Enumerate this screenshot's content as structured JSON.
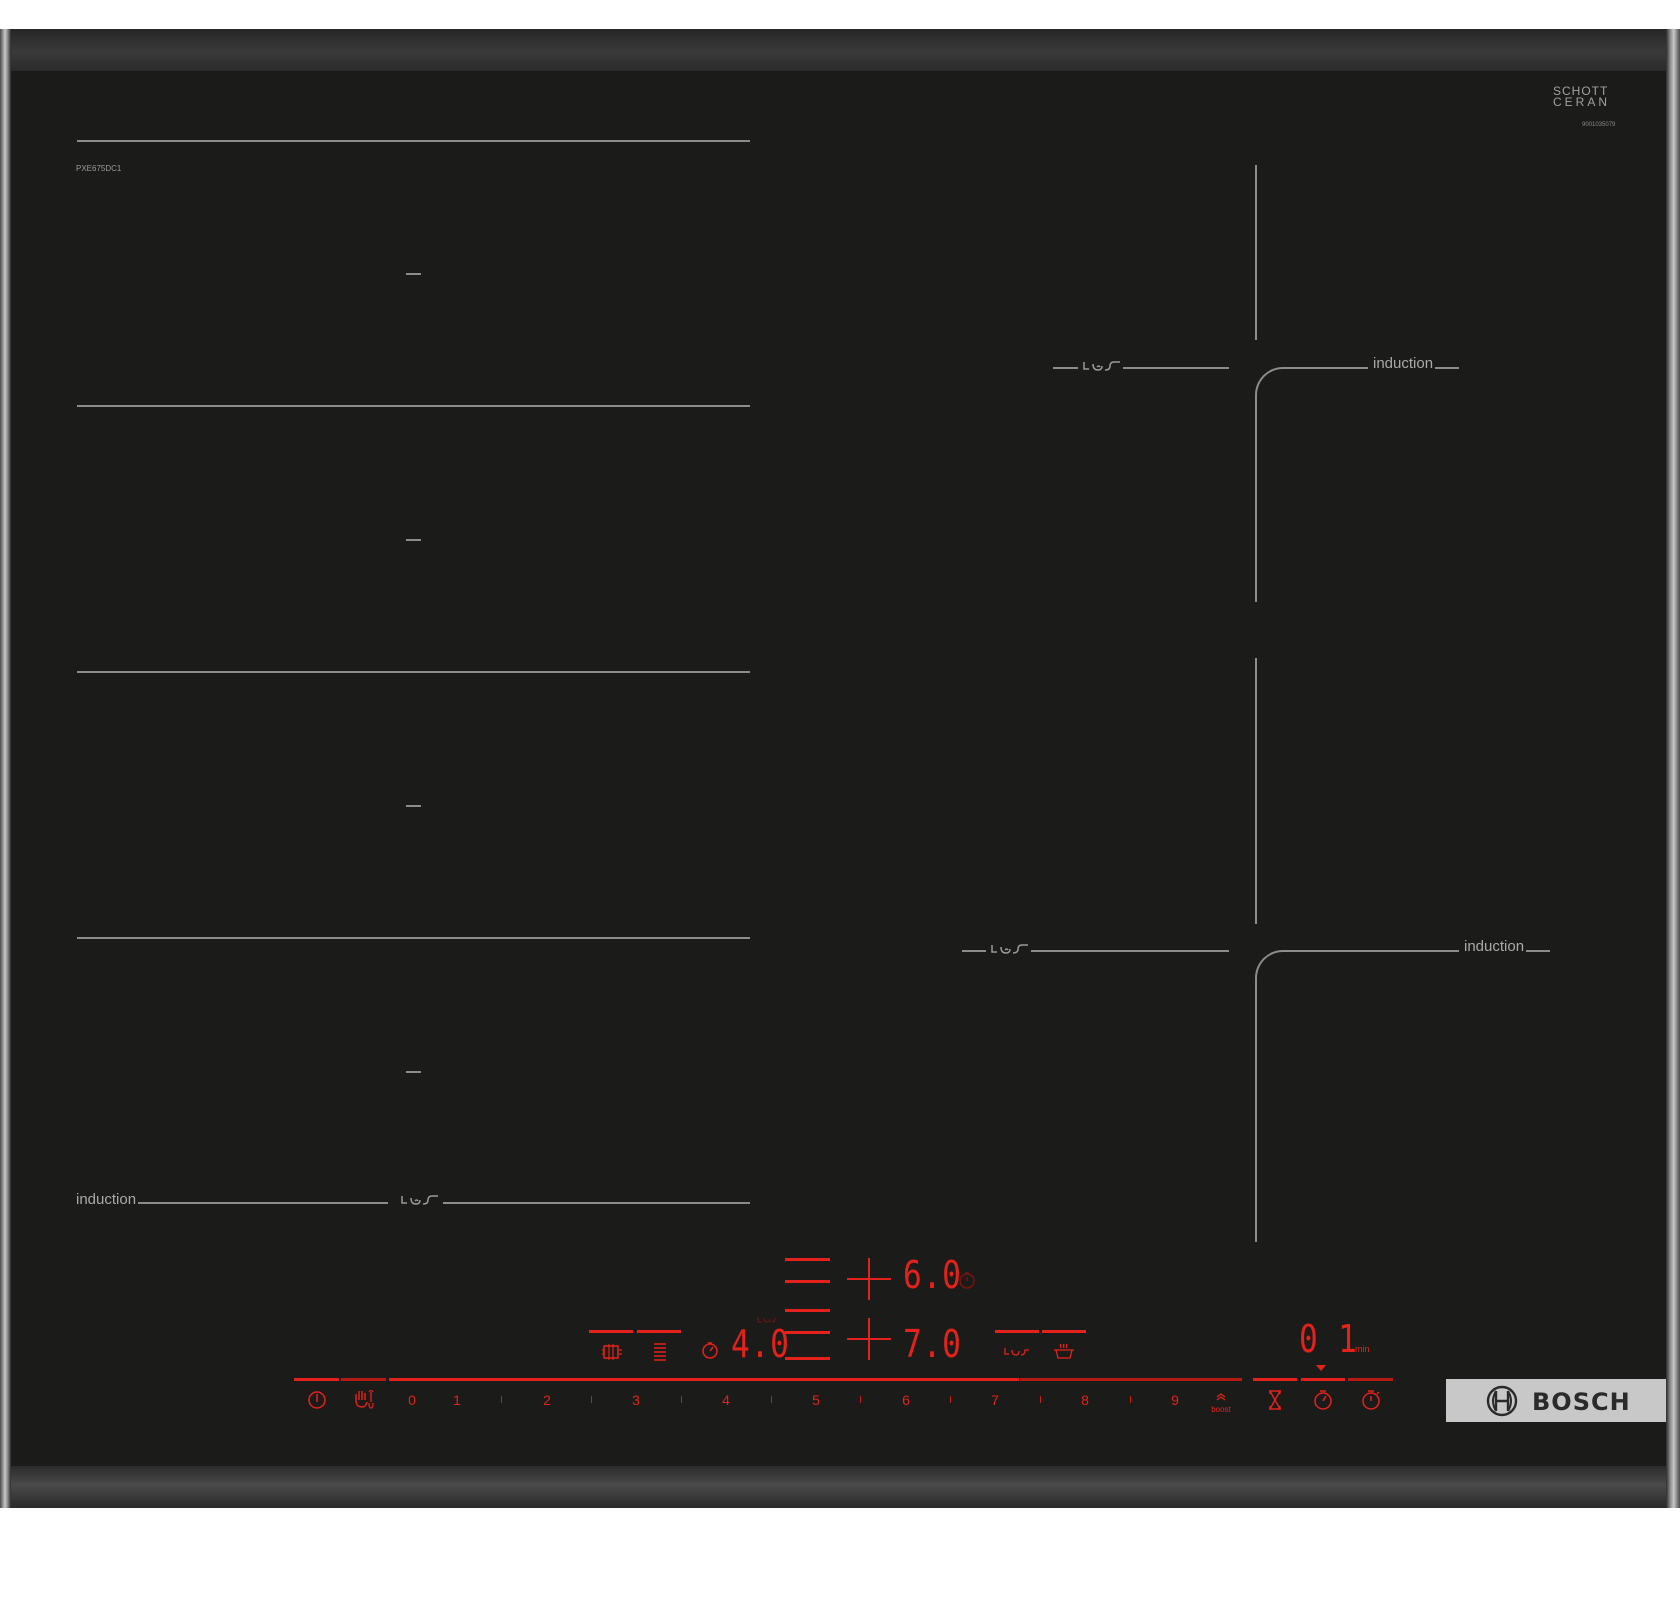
{
  "product": {
    "brand": "BOSCH",
    "model": "PXE675DC1",
    "glass_brand_line1": "SCHOTT",
    "glass_brand_line2": "CERAN",
    "glass_serial": "9001035079"
  },
  "cooking_zones": {
    "left_flex_label": "induction",
    "right_top_label": "induction",
    "right_bottom_label": "induction"
  },
  "display": {
    "top_zone_level": "6.0",
    "bottom_zone_level": "7.0",
    "left_timer_level": "4.0",
    "timer_minutes": "0 1",
    "timer_unit": "min"
  },
  "power_scale": {
    "levels": [
      "0",
      "1",
      "2",
      "3",
      "4",
      "5",
      "6",
      "7",
      "8",
      "9"
    ],
    "boost_label": "boost"
  },
  "colors": {
    "glass": "#1b1b1a",
    "display_red": "#e4221b",
    "printed_lines": "#8c8c8c"
  },
  "icons": {
    "power": "power-icon",
    "child_lock": "hand-lock-icon",
    "cooking_sensor": "cooking-sensor-icon",
    "pan_sensor": "pan-sensor-icon",
    "countdown": "hourglass-icon",
    "timer": "timer-icon",
    "stopwatch": "stopwatch-icon"
  }
}
